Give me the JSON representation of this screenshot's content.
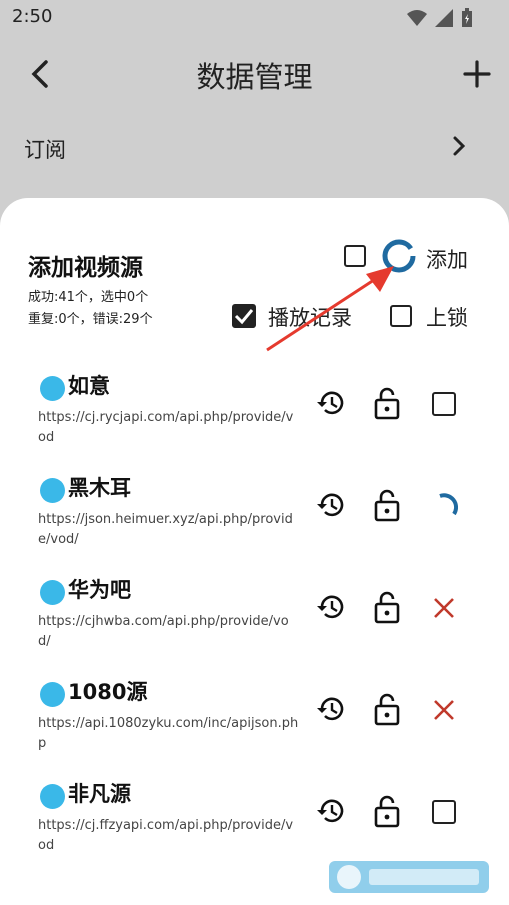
{
  "status_bar": {
    "time": "2:50"
  },
  "app_bar": {
    "title": "数据管理"
  },
  "subscription_row": {
    "label": "订阅"
  },
  "sheet": {
    "title": "添加视频源",
    "stats_line1": "成功:41个，选中0个",
    "stats_line2": "重复:0个，错误:29个",
    "add_label": "添加",
    "history_label": "播放记录",
    "lock_label": "上锁"
  },
  "sources": [
    {
      "name": "如意",
      "url": "https://cj.rycjapi.com/api.php/provide/vod",
      "state": "checkbox"
    },
    {
      "name": "黑木耳",
      "url": "https://json.heimuer.xyz/api.php/provide/vod/",
      "state": "loading"
    },
    {
      "name": "华为吧",
      "url": "https://cjhwba.com/api.php/provide/vod/",
      "state": "error"
    },
    {
      "name": "1080源",
      "url": "https://api.1080zyku.com/inc/apijson.php",
      "state": "error"
    },
    {
      "name": "非凡源",
      "url": "https://cj.ffzyapi.com/api.php/provide/vod",
      "state": "checkbox"
    }
  ],
  "colors": {
    "accent": "#1f6aa0",
    "dot": "#3ab8e8",
    "error": "#c0392b",
    "arrow": "#e53a2e"
  },
  "icons": [
    "wifi-icon",
    "signal-icon",
    "battery-icon",
    "back-icon",
    "plus-icon",
    "chevron-right-icon",
    "history-icon",
    "unlock-icon",
    "close-icon",
    "spinner-icon"
  ]
}
